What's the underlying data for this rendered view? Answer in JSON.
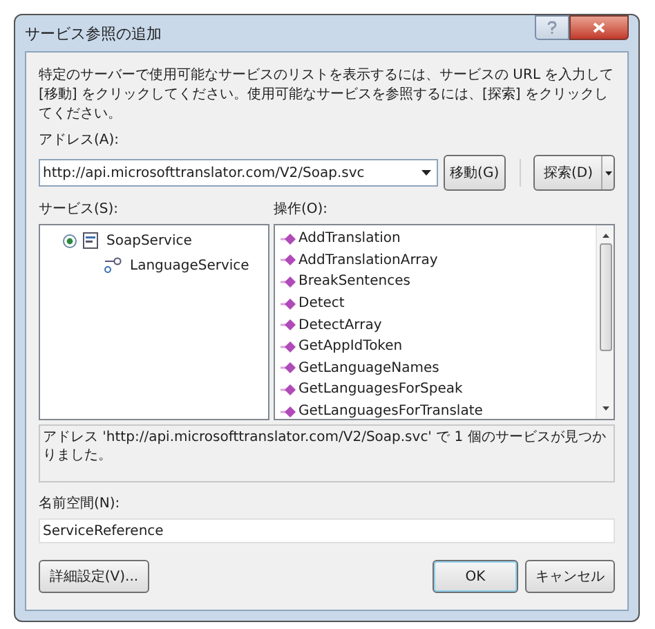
{
  "window": {
    "title": "サービス参照の追加"
  },
  "instructions": "特定のサーバーで使用可能なサービスのリストを表示するには、サービスの URL を入力して [移動] をクリックしてください。使用可能なサービスを参照するには、[探索] をクリックしてください。",
  "address": {
    "label": "アドレス(A):",
    "value": "http://api.microsofttranslator.com/V2/Soap.svc",
    "go_button": "移動(G)",
    "discover_button": "探索(D)"
  },
  "services": {
    "label": "サービス(S):",
    "items": [
      {
        "name": "SoapService",
        "expanded": true,
        "kind": "service",
        "children": [
          {
            "name": "LanguageService",
            "kind": "contract"
          }
        ]
      }
    ]
  },
  "operations": {
    "label": "操作(O):",
    "items": [
      "AddTranslation",
      "AddTranslationArray",
      "BreakSentences",
      "Detect",
      "DetectArray",
      "GetAppIdToken",
      "GetLanguageNames",
      "GetLanguagesForSpeak",
      "GetLanguagesForTranslate"
    ]
  },
  "status": "アドレス 'http://api.microsofttranslator.com/V2/Soap.svc' で 1 個のサービスが見つかりました。",
  "namespace": {
    "label": "名前空間(N):",
    "value": "ServiceReference"
  },
  "buttons": {
    "advanced": "詳細設定(V)...",
    "ok": "OK",
    "cancel": "キャンセル"
  }
}
